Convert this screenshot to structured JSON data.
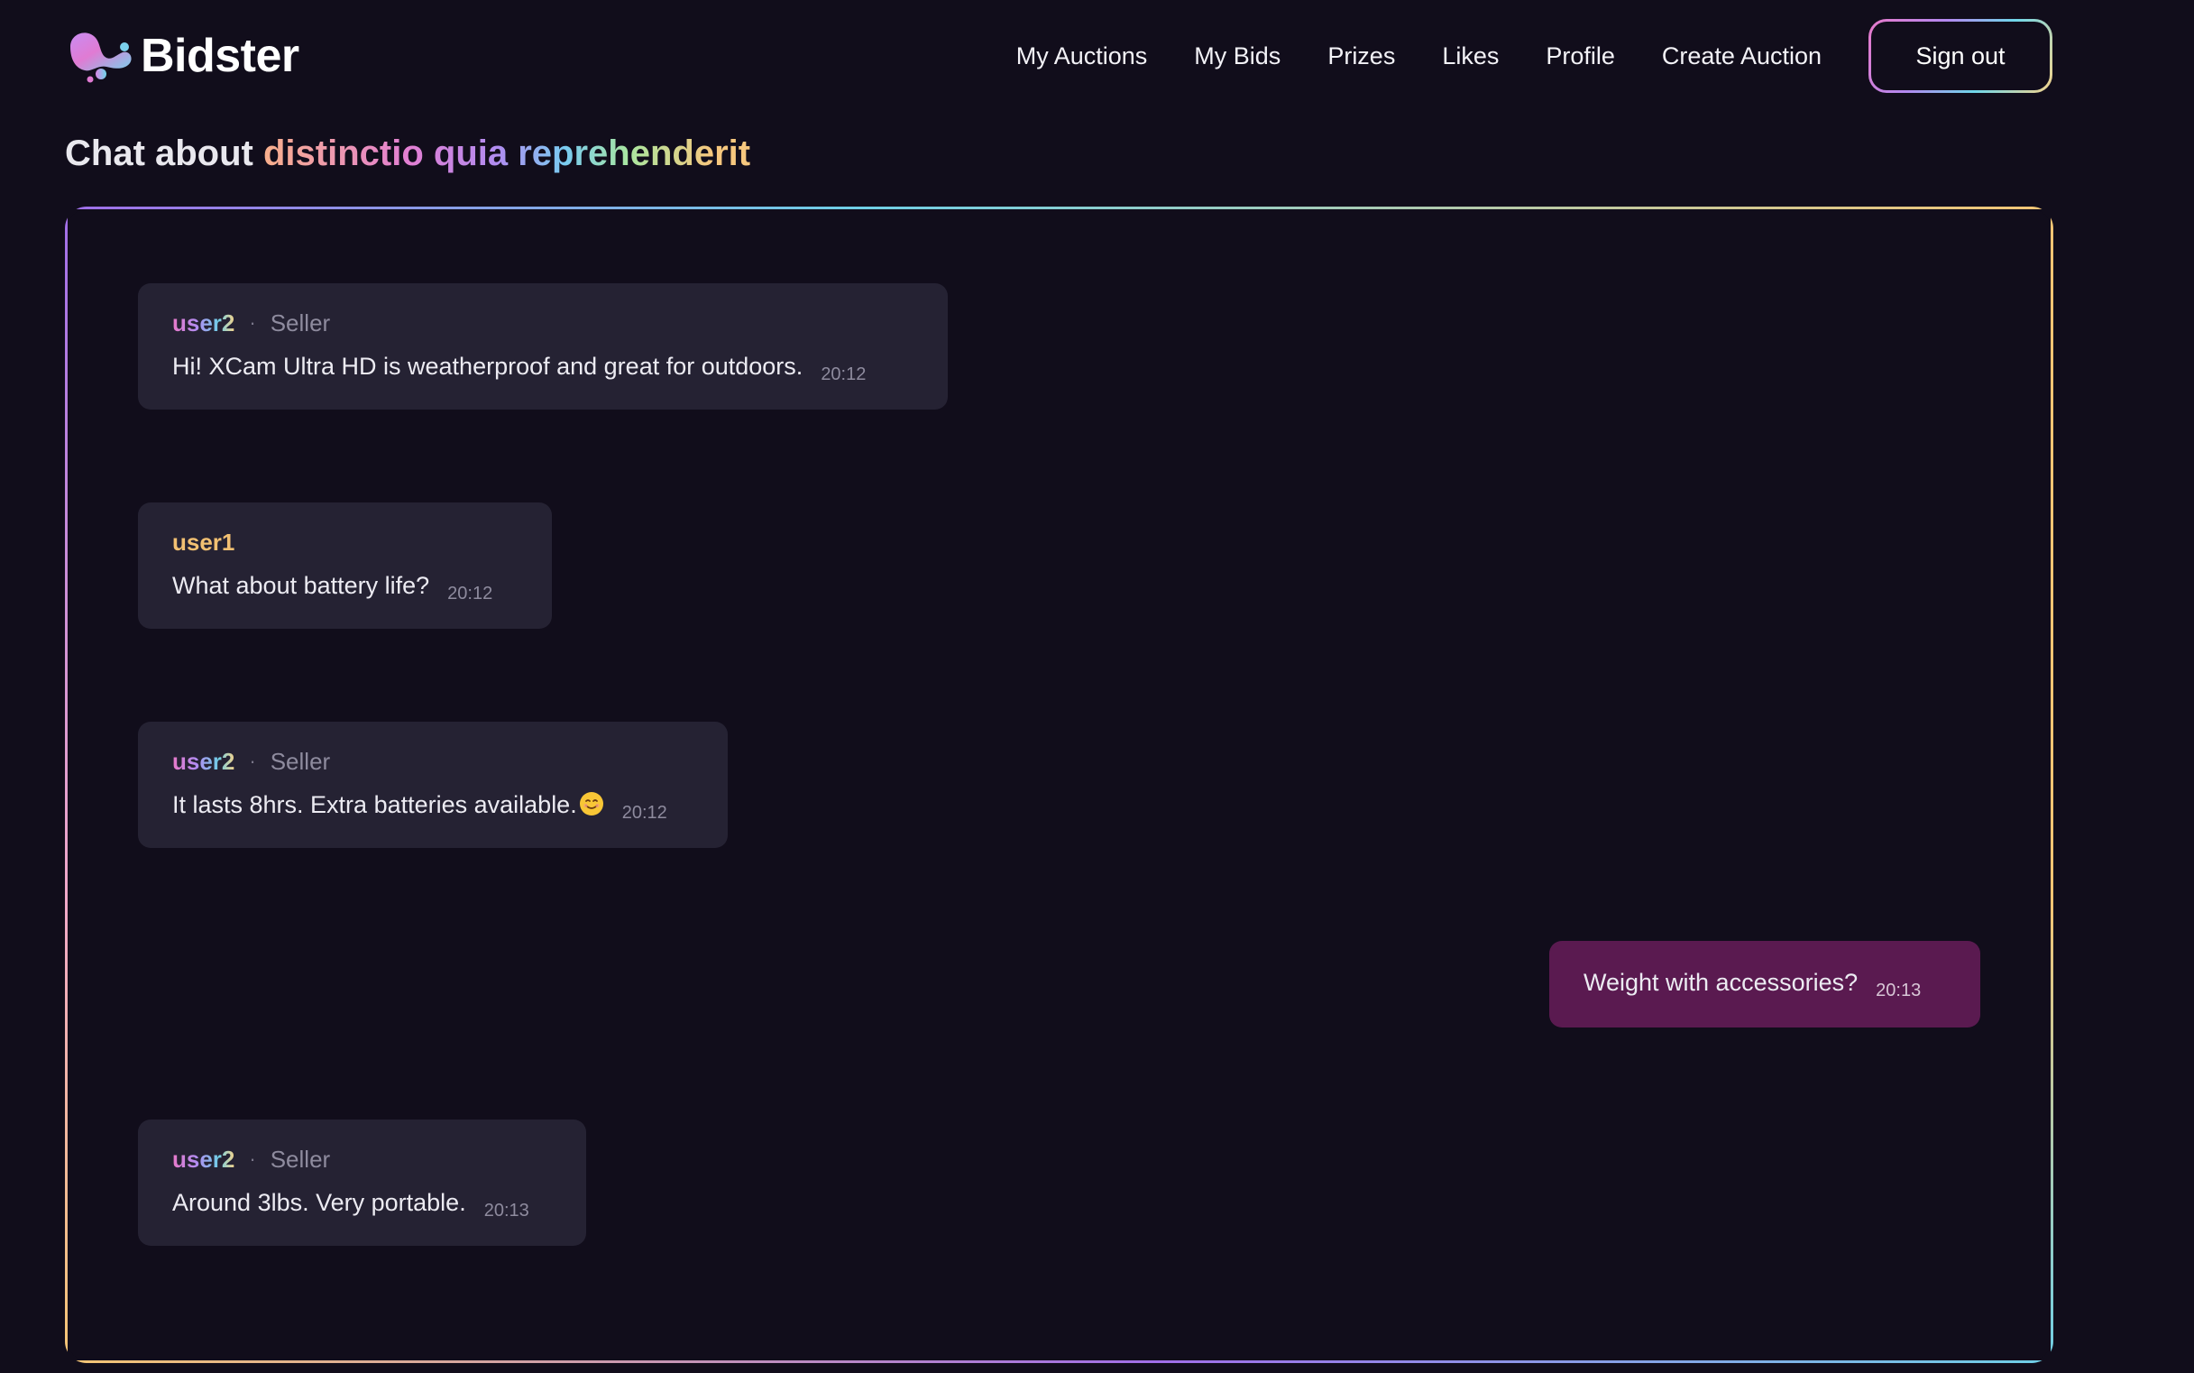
{
  "app": {
    "name": "Bidster"
  },
  "nav": {
    "items": [
      "My Auctions",
      "My Bids",
      "Prizes",
      "Likes",
      "Profile",
      "Create Auction"
    ],
    "signout_label": "Sign out"
  },
  "page": {
    "title_prefix": "Chat about",
    "title_subject": "distinctio quia reprehenderit"
  },
  "chat": {
    "messages": [
      {
        "sender": "user2",
        "role": "Seller",
        "separator": "·",
        "text": "Hi! XCam Ultra HD is weatherproof and great for outdoors.",
        "time": "20:12",
        "own": false
      },
      {
        "sender": "user1",
        "role": "",
        "separator": "",
        "text": "What about battery life?",
        "time": "20:12",
        "own": false
      },
      {
        "sender": "user2",
        "role": "Seller",
        "separator": "·",
        "text": "It lasts 8hrs. Extra batteries available.",
        "emoji": "smiling-face-emoji",
        "time": "20:12",
        "own": false
      },
      {
        "sender": "",
        "role": "",
        "separator": "",
        "text": "Weight with accessories?",
        "time": "20:13",
        "own": true
      },
      {
        "sender": "user2",
        "role": "Seller",
        "separator": "·",
        "text": "Around 3lbs. Very portable.",
        "time": "20:13",
        "own": false
      }
    ]
  },
  "colors": {
    "background": "#110d1b",
    "bubble": "#252233",
    "own_bubble": "#5a1a50",
    "user1": "#f2c072",
    "muted": "#8e8b9e"
  }
}
